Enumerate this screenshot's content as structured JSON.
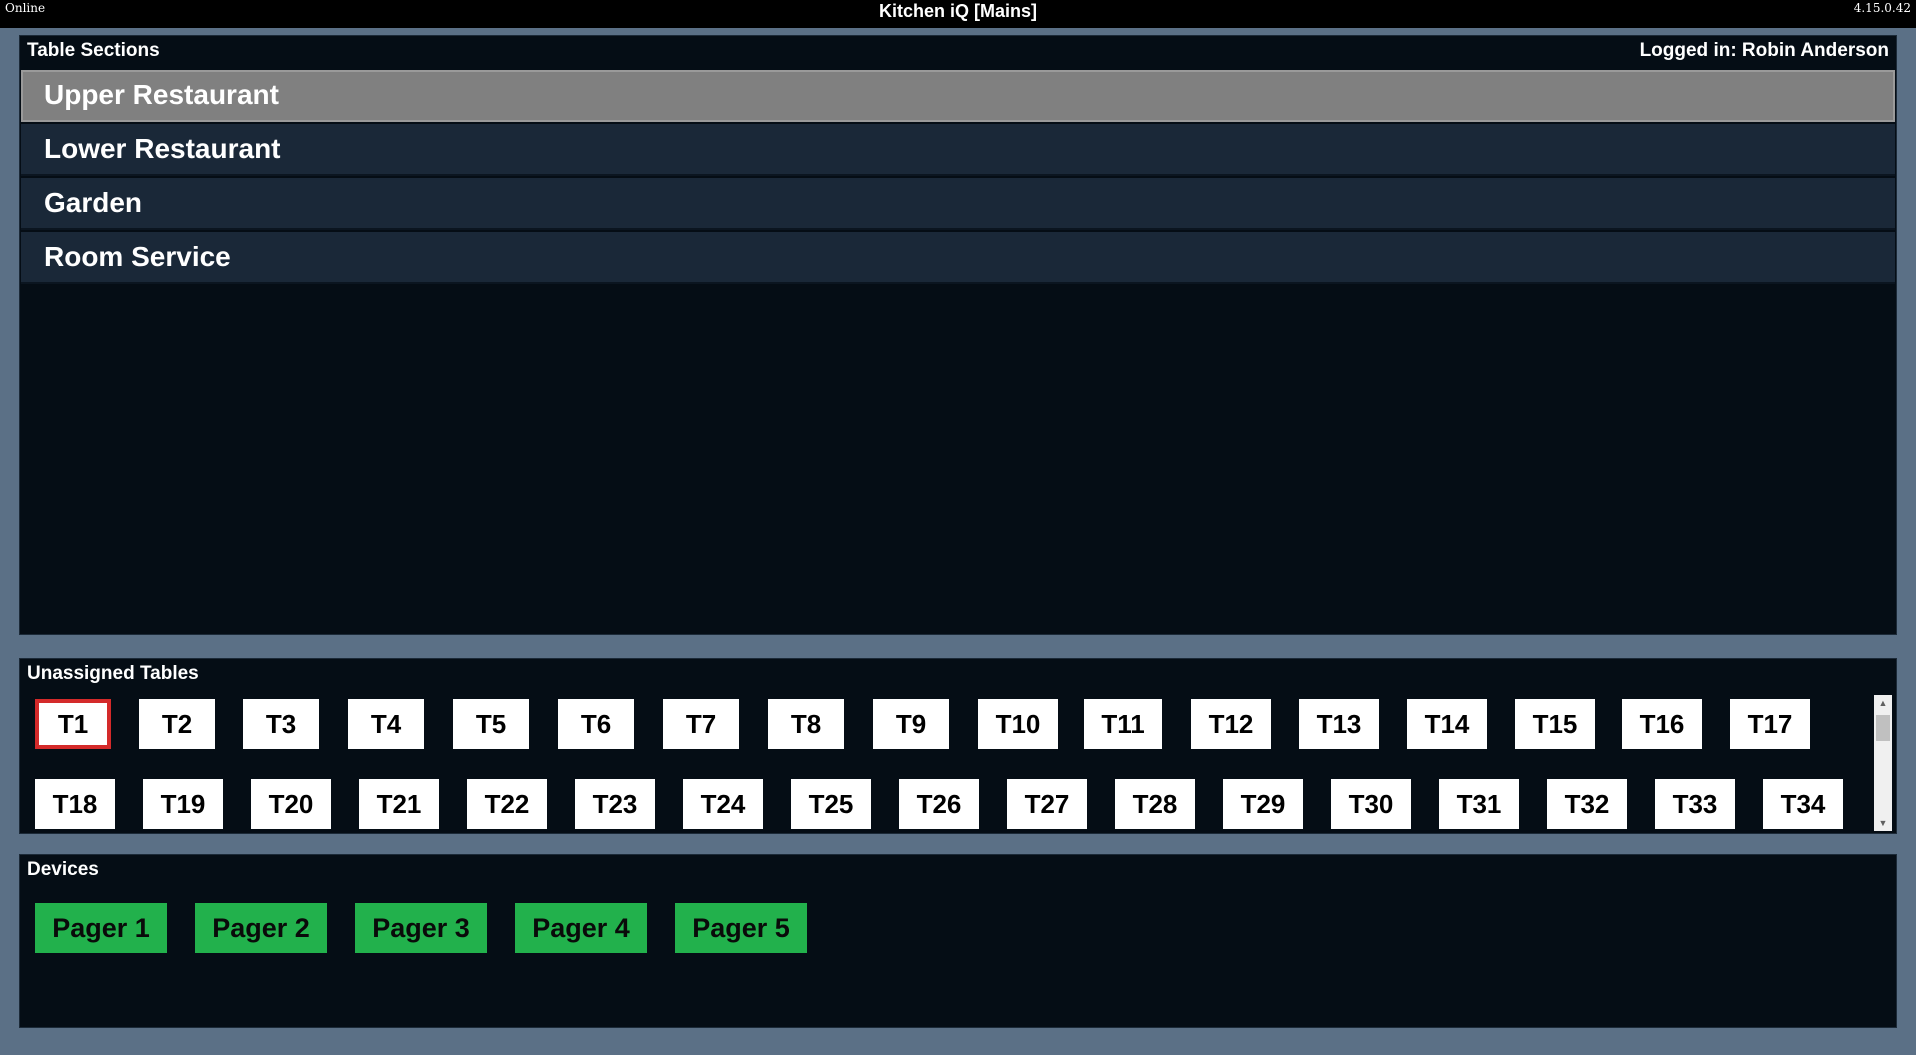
{
  "titlebar": {
    "status": "Online",
    "title": "Kitchen iQ [Mains]",
    "version": "4.15.0.42"
  },
  "sections_panel": {
    "header": "Table Sections",
    "logged_in": "Logged in: Robin Anderson",
    "items": [
      {
        "label": "Upper Restaurant",
        "selected": true
      },
      {
        "label": "Lower Restaurant",
        "selected": false
      },
      {
        "label": "Garden",
        "selected": false
      },
      {
        "label": "Room Service",
        "selected": false
      }
    ]
  },
  "tables_panel": {
    "header": "Unassigned Tables",
    "selected": "T1",
    "tables": [
      "T1",
      "T2",
      "T3",
      "T4",
      "T5",
      "T6",
      "T7",
      "T8",
      "T9",
      "T10",
      "T11",
      "T12",
      "T13",
      "T14",
      "T15",
      "T16",
      "T17",
      "T18",
      "T19",
      "T20",
      "T21",
      "T22",
      "T23",
      "T24",
      "T25",
      "T26",
      "T27",
      "T28",
      "T29",
      "T30",
      "T31",
      "T32",
      "T33",
      "T34"
    ]
  },
  "devices_panel": {
    "header": "Devices",
    "devices": [
      "Pager 1",
      "Pager 2",
      "Pager 3",
      "Pager 4",
      "Pager 5"
    ]
  },
  "colors": {
    "background": "#5b7086",
    "panel": "#050d15",
    "section_item": "#1a2838",
    "section_selected": "#808080",
    "device_button": "#22b14c",
    "table_selected_border": "#d42a2a"
  }
}
